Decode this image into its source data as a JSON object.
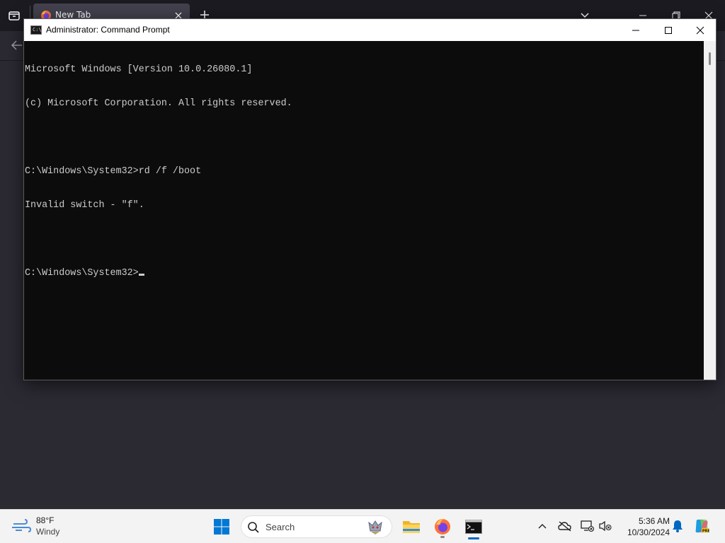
{
  "browser": {
    "tab_title": "New Tab"
  },
  "cmd": {
    "title": "Administrator: Command Prompt",
    "icon_text": "C:\\",
    "lines": [
      "Microsoft Windows [Version 10.0.26080.1]",
      "(c) Microsoft Corporation. All rights reserved.",
      "",
      "C:\\Windows\\System32>rd /f /boot",
      "Invalid switch - \"f\".",
      ""
    ],
    "prompt": "C:\\Windows\\System32>"
  },
  "taskbar": {
    "weather_temp": "88°F",
    "weather_desc": "Windy",
    "search_label": "Search",
    "clock_time": "5:36 AM",
    "clock_date": "10/30/2024",
    "accent": "#0067c0"
  },
  "icons": {
    "browser": [
      "tab-list-icon",
      "firefox-icon",
      "close-icon",
      "plus-icon",
      "chevron-down-icon",
      "minimize-icon",
      "restore-icon",
      "close-icon",
      "back-arrow-icon"
    ],
    "cmd": [
      "cmd-icon",
      "minimize-icon",
      "maximize-icon",
      "close-icon"
    ],
    "taskbar": [
      "weather-wind-icon",
      "windows-start-icon",
      "search-icon",
      "file-explorer-icon",
      "firefox-icon",
      "terminal-icon",
      "chevron-up-icon",
      "onedrive-icon",
      "network-icon",
      "volume-muted-icon",
      "bell-icon",
      "copilot-icon"
    ]
  }
}
